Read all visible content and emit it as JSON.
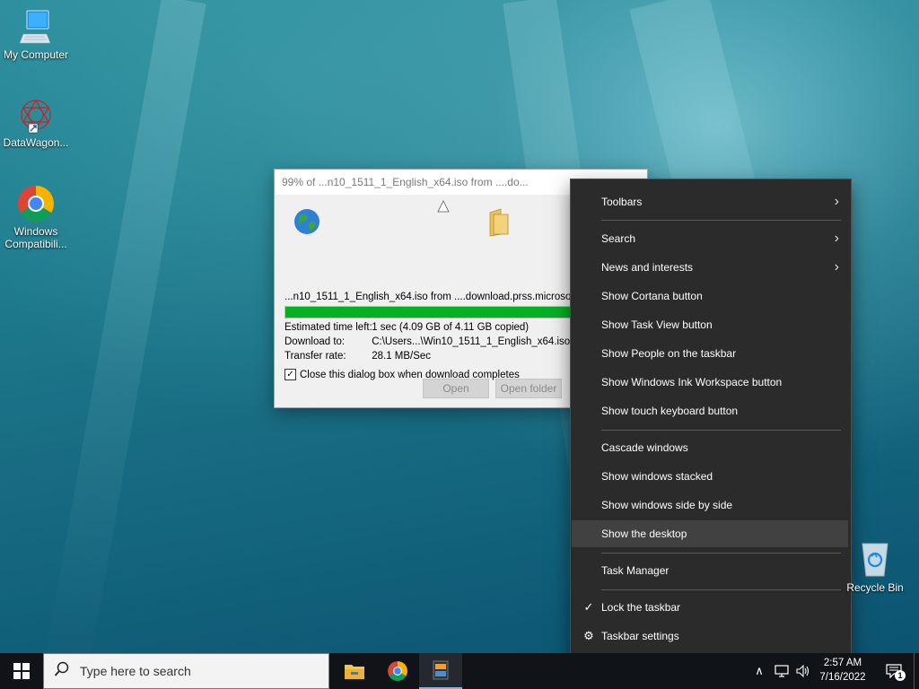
{
  "desktop": {
    "icons": [
      {
        "label": "My Computer",
        "icon": "monitor-icon"
      },
      {
        "label": "DataWagon...",
        "icon": "datawagon-logo-icon"
      },
      {
        "label": "Windows Compatibili...",
        "icon": "chrome-icon"
      }
    ],
    "recycle_bin": {
      "label": "Recycle Bin",
      "icon": "recycle-bin-icon"
    }
  },
  "download_dialog": {
    "title": "99% of ...n10_1511_1_English_x64.iso from ....do...",
    "minimize_glyph": "—",
    "source_path": "...n10_1511_1_English_x64.iso from ....download.prss.microsoft",
    "progress_percent": 99,
    "rows": [
      {
        "key": "Estimated time left:",
        "value": "1 sec (4.09 GB of 4.11 GB copied)"
      },
      {
        "key": "Download to:",
        "value": "C:\\Users...\\Win10_1511_1_English_x64.iso"
      },
      {
        "key": "Transfer rate:",
        "value": "28.1 MB/Sec"
      }
    ],
    "close_when_done": {
      "label": "Close this dialog box when download completes",
      "checked": true
    },
    "buttons": {
      "open": "Open",
      "open_folder": "Open folder"
    }
  },
  "context_menu": {
    "items": [
      {
        "label": "Toolbars",
        "submenu": true
      },
      {
        "label": "Search",
        "submenu": true
      },
      {
        "label": "News and interests",
        "submenu": true
      },
      {
        "label": "Show Cortana button"
      },
      {
        "label": "Show Task View button"
      },
      {
        "label": "Show People on the taskbar"
      },
      {
        "label": "Show Windows Ink Workspace button"
      },
      {
        "label": "Show touch keyboard button"
      },
      {
        "label": "Cascade windows"
      },
      {
        "label": "Show windows stacked"
      },
      {
        "label": "Show windows side by side"
      },
      {
        "label": "Show the desktop",
        "highlighted": true
      },
      {
        "label": "Task Manager"
      },
      {
        "label": "Lock the taskbar",
        "checked": true
      },
      {
        "label": "Taskbar settings",
        "icon": "gear-icon"
      }
    ],
    "submenu_arrow": "›",
    "check_glyph": "✓",
    "gear_glyph": "⚙"
  },
  "taskbar": {
    "search_placeholder": "Type here to search",
    "apps": [
      "file-explorer-icon",
      "chrome-icon",
      "app-icon"
    ],
    "tray": {
      "chevron": "∧"
    },
    "clock": {
      "time": "2:57 AM",
      "date": "7/16/2022"
    },
    "notification_count": "1"
  },
  "colors": {
    "progress": "#06b025",
    "menu_bg": "#2b2b2b",
    "menu_highlight": "#414141"
  }
}
